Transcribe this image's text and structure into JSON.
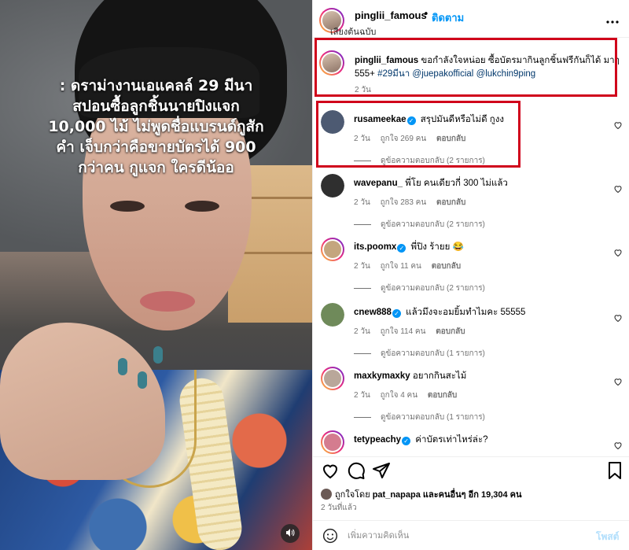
{
  "media": {
    "overlay_lines": [
      ": ดราม่างานเอแคลล์ 29 มีนา",
      "สปอนซื้อลูกชิ้นนายปิงแจก",
      "10,000 ไม้ ไม่พูดชื่อแบรนด์กูสัก",
      "คำ เจ็บกว่าคือขายบัตรได้ 900",
      "กว่าคน กูแจก ใครดีน้ออ"
    ],
    "audio_icon": "speaker-icon"
  },
  "header": {
    "username": "pinglii_famous",
    "dot": "•",
    "follow_label": "ติดตาม",
    "subtitle": "เสียงต้นฉบับ",
    "more_icon": "more-horizontal-icon"
  },
  "caption": {
    "username": "pinglii_famous",
    "text": "ขอกำลังใจหน่อย ซื้อบัตรมากินลูกชิ้นฟรีกันก็ได้ มาๆ 555+",
    "hashtag": "#29มีนา",
    "mention1": "@juepakofficial",
    "mention2": "@lukchin9ping",
    "time": "2 วัน"
  },
  "comments": [
    {
      "username": "rusameekae",
      "verified": true,
      "text": "สรุปมันดีหรือไม่ดี กูงง",
      "time": "2 วัน",
      "likes": "ถูกใจ 269 คน",
      "reply": "ตอบกลับ",
      "replies": "ดูข้อความตอบกลับ (2 รายการ)",
      "avatar_color": "#4d5a72"
    },
    {
      "username": "wavepanu_",
      "verified": false,
      "text": "พี่โย คนเดียวกี่ 300 ไม่แล้ว",
      "time": "2 วัน",
      "likes": "ถูกใจ 283 คน",
      "reply": "ตอบกลับ",
      "replies": "ดูข้อความตอบกลับ (2 รายการ)",
      "avatar_color": "#2f2f2f"
    },
    {
      "username": "its.poomx",
      "verified": true,
      "text": "พี่ปิง ร้ายย 😂",
      "time": "2 วัน",
      "likes": "ถูกใจ 11 คน",
      "reply": "ตอบกลับ",
      "replies": "ดูข้อความตอบกลับ (2 รายการ)",
      "avatar_color": "#c4a67e"
    },
    {
      "username": "cnew888",
      "verified": true,
      "text": "แล้วมึงจะอมยิ้มทำไมคะ 55555",
      "time": "2 วัน",
      "likes": "ถูกใจ 114 คน",
      "reply": "ตอบกลับ",
      "replies": "ดูข้อความตอบกลับ (1 รายการ)",
      "avatar_color": "#6f8a5a"
    },
    {
      "username": "maxkymaxky",
      "verified": false,
      "text": "อยากกินสะไม้",
      "time": "2 วัน",
      "likes": "ถูกใจ 4 คน",
      "reply": "ตอบกลับ",
      "replies": "ดูข้อความตอบกลับ (1 รายการ)",
      "avatar_color": "#b9a79a"
    },
    {
      "username": "tetypeachy",
      "verified": true,
      "text": "ค่าบัตรเท่าไหร่ล่ะ?",
      "time": "",
      "likes": "",
      "reply": "",
      "replies": "",
      "avatar_color": "#d47c8f"
    }
  ],
  "actions": {
    "like_icon": "heart-icon",
    "comment_icon": "comment-icon",
    "share_icon": "paper-plane-icon",
    "save_icon": "bookmark-icon"
  },
  "likes": {
    "prefix": "ถูกใจโดย",
    "user": "pat_napapa",
    "middle": "และคนอื่นๆ อีก",
    "count": "19,304 คน"
  },
  "post_time": "2 วันที่แล้ว",
  "add_comment": {
    "placeholder": "เพิ่มความคิดเห็น",
    "post_label": "โพสต์",
    "emoji_icon": "emoji-icon"
  },
  "colors": {
    "accent": "#0095f6",
    "highlight_box": "#d0021b"
  }
}
